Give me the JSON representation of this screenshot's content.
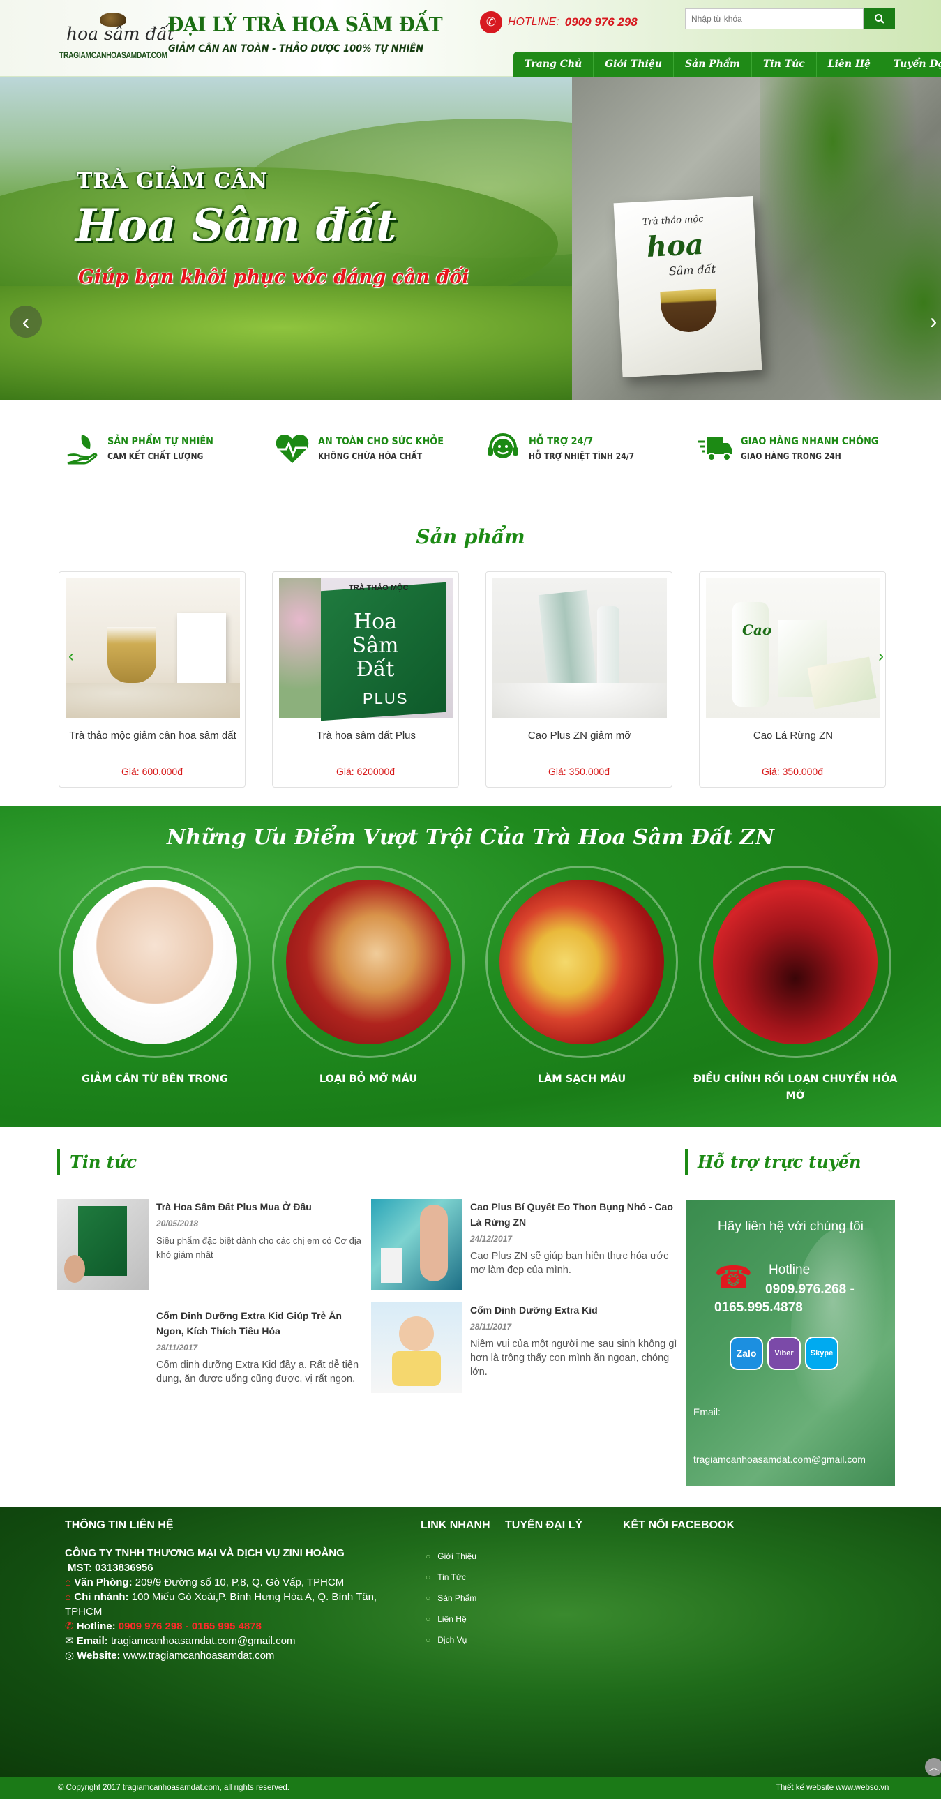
{
  "header": {
    "logo_script": "hoa sâm đất",
    "logo_url": "TRAGIAMCANHOASAMDAT.COM",
    "brand_title": "ĐẠI LÝ TRÀ HOA SÂM ĐẤT",
    "brand_subtitle": "GIẢM CÂN AN TOÀN - THẢO DƯỢC 100% TỰ NHIÊN",
    "hotline_label": "HOTLINE:",
    "hotline_number": "0909 976 298",
    "search_placeholder": "Nhập từ khóa",
    "nav": [
      "Trang Chủ",
      "Giới Thiệu",
      "Sản Phẩm",
      "Tin Tức",
      "Liên Hệ",
      "Tuyển Đại Lý"
    ]
  },
  "banner": {
    "line1": "TRÀ GIẢM CÂN",
    "line2": "Hoa Sâm đất",
    "line3": "Giúp bạn khôi phục vóc dáng cân đối",
    "box_line1": "Trà thảo mộc",
    "box_line2": "hoa",
    "box_line3": "Sâm đất"
  },
  "features": [
    {
      "title": "SẢN PHẨM TỰ NHIÊN",
      "sub": "CAM KẾT CHẤT LƯỢNG",
      "icon": "leaf-hand-icon"
    },
    {
      "title": "AN TOÀN CHO SỨC KHỎE",
      "sub": "KHÔNG CHỨA HÓA CHẤT",
      "icon": "heartbeat-icon"
    },
    {
      "title": "HỖ TRỢ 24/7",
      "sub": "HỖ TRỢ NHIỆT TÌNH 24/7",
      "icon": "headset-icon"
    },
    {
      "title": "GIAO HÀNG NHANH CHÓNG",
      "sub": "GIAO HÀNG TRONG 24H",
      "icon": "truck-icon"
    }
  ],
  "products": {
    "title": "Sản phẩm",
    "items": [
      {
        "name": "Trà thảo mộc giảm cân hoa sâm đất",
        "price": "Giá: 600.000đ"
      },
      {
        "name": "Trà hoa sâm đất Plus",
        "price": "Giá: 620000đ"
      },
      {
        "name": "Cao Plus ZN giảm mỡ",
        "price": "Giá: 350.000đ"
      },
      {
        "name": "Cao Lá Rừng ZN",
        "price": "Giá: 350.000đ"
      }
    ],
    "img2_top": "TRÀ THẢO MỘC",
    "img2_main": "Hoa Sâm Đất",
    "img2_plus": "PLUS",
    "img4_label": "Cao"
  },
  "advantages": {
    "title": "Những Ưu Điểm Vượt Trội Của Trà Hoa Sâm Đất ZN",
    "items": [
      "GIẢM CÂN TỪ BÊN TRONG",
      "LOẠI BỎ MỠ MÁU",
      "LÀM SẠCH MÁU",
      "ĐIỀU CHỈNH RỐI LOẠN CHUYỂN HÓA MỠ"
    ]
  },
  "news": {
    "title": "Tin tức",
    "items": [
      {
        "title": "Trà Hoa Sâm Đất Plus Mua Ở Đâu",
        "date": "20/05/2018",
        "desc": "Siêu phẩm đặc biệt dành cho các chị em có Cơ địa khó giảm nhất"
      },
      {
        "title": "Cao Plus Bí Quyết Eo Thon Bụng Nhỏ - Cao Lá Rừng ZN",
        "date": "24/12/2017",
        "desc": "Cao Plus ZN sẽ giúp bạn hiện thực hóa ước mơ làm đẹp của mình."
      },
      {
        "title": "Cốm Dinh Dưỡng Extra Kid Giúp Trẻ Ăn Ngon, Kích Thích Tiêu Hóa",
        "date": "28/11/2017",
        "desc": "Cốm dinh dưỡng Extra Kid đầy a. Rất dễ tiện dụng, ăn được uống cũng được, vị rất ngon."
      },
      {
        "title": "Cốm Dinh Dưỡng Extra Kid",
        "date": "28/11/2017",
        "desc": " Niềm vui của một người mẹ sau sinh không gì hơn là trông thấy con mình ăn ngoan, chóng lớn."
      }
    ]
  },
  "support": {
    "title": "Hỗ trợ trực tuyến",
    "contact": "Hãy liên hệ với chúng tôi",
    "hotline_label": "Hotline",
    "phone1": "0909.976.268 -",
    "phone2": "0165.995.4878",
    "social": [
      "Zalo",
      "Viber",
      "Skype"
    ],
    "email_label": "Email:",
    "email": "tragiamcanhoasamdat.com@gmail.com"
  },
  "footer": {
    "h_contact": "THÔNG TIN LIÊN HỆ",
    "h_links": "LINK NHANH",
    "h_agent": "TUYỂN ĐẠI LÝ",
    "h_facebook": "KẾT NỐI FACEBOOK",
    "company": "CÔNG TY TNHH THƯƠNG MẠI VÀ DỊCH VỤ ZINI HOÀNG",
    "mst": "MST: 0313836956",
    "office_label": "Văn Phòng:",
    "office": "209/9 Đường số 10, P.8, Q. Gò Vấp, TPHCM",
    "branch_label": "Chi nhánh:",
    "branch": "100 Miếu Gò Xoài,P. Bình Hưng Hòa A, Q. Bình Tân, TPHCM",
    "hotline_label": "Hotline:",
    "hotline": "0909 976 298 - 0165 995 4878",
    "email_label": "Email:",
    "email": "tragiamcanhoasamdat.com@gmail.com",
    "website_label": "Website:",
    "website": "www.tragiamcanhoasamdat.com",
    "links": [
      "Giới Thiệu",
      "Tin Tức",
      "Sản Phẩm",
      "Liên Hệ",
      "Dịch Vụ"
    ],
    "copyright": "© Copyright 2017 tragiamcanhoasamdat.com, all rights reserved.",
    "designer": "Thiết kế website www.webso.vn"
  },
  "colors": {
    "brand_green": "#1c8a14",
    "accent_red": "#d71920"
  }
}
